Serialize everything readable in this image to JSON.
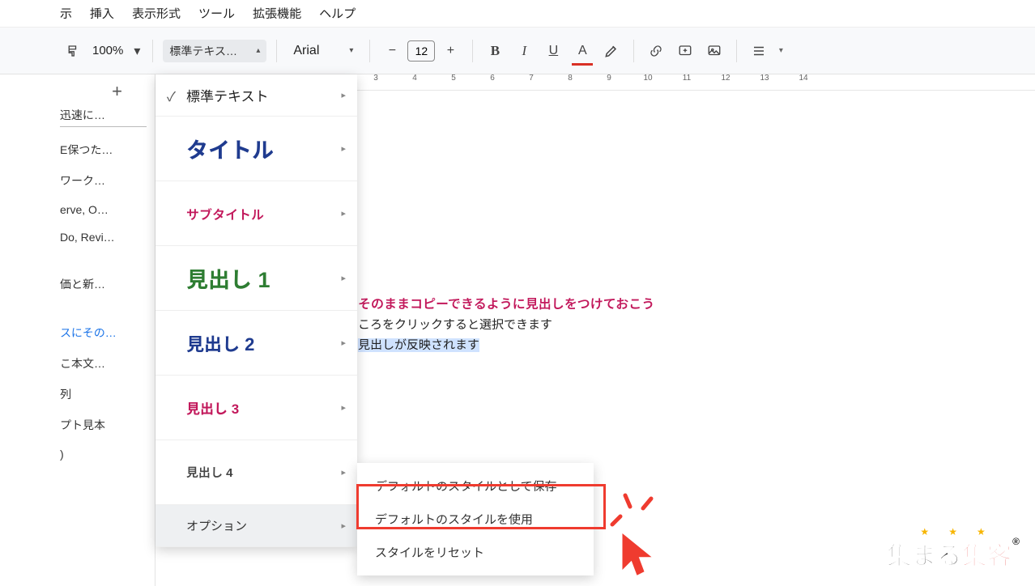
{
  "menubar": {
    "view": "示",
    "insert": "挿入",
    "format": "表示形式",
    "tools": "ツール",
    "extensions": "拡張機能",
    "help": "ヘルプ"
  },
  "toolbar": {
    "zoom": "100%",
    "style_select": "標準テキス…",
    "font": "Arial",
    "size": "12",
    "bold": "B",
    "italic": "I",
    "underline": "U",
    "textcolor": "A"
  },
  "ruler_labels": [
    "3",
    "4",
    "5",
    "6",
    "7",
    "8",
    "9",
    "10",
    "11",
    "12",
    "13",
    "14"
  ],
  "sidebar": {
    "items": [
      "迅速に…",
      "E保つた…",
      "ワーク…",
      "erve, O…",
      "Do, Revi…",
      "価と新…",
      "スにその…",
      "こ本文…",
      "列",
      "プト見本",
      ")"
    ],
    "active_index": 6
  },
  "styles_menu": {
    "normal": "標準テキスト",
    "title": "タイトル",
    "subtitle": "サブタイトル",
    "h1": "見出し 1",
    "h2": "見出し 2",
    "h3": "見出し 3",
    "h4": "見出し 4",
    "options": "オプション"
  },
  "submenu": {
    "save_default": "デフォルトのスタイルとして保存",
    "use_default": "デフォルトのスタイルを使用",
    "reset": "スタイルをリセット"
  },
  "document": {
    "line1": "そのままコピーできるように見出しをつけておこう",
    "line2": "ころをクリックすると選択できます",
    "line3": "見出しが反映されます"
  },
  "brand": {
    "part1": "集まる",
    "part2": "集客"
  }
}
